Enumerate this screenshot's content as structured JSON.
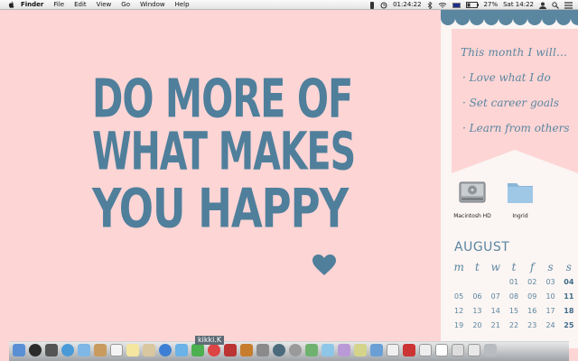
{
  "menubar": {
    "items": [
      "Finder",
      "File",
      "Edit",
      "View",
      "Go",
      "Window",
      "Help"
    ],
    "clock": "01:24:22",
    "battery": "27%",
    "datetime": "Sat 14:22"
  },
  "quote": {
    "line1": "DO MORE OF",
    "line2": "WHAT MAKES",
    "line3": "YOU HAPPY"
  },
  "note": {
    "header": "This month I will...",
    "items": [
      "Love what I do",
      "Set career goals",
      "Learn from others"
    ]
  },
  "desktop": {
    "icons": [
      {
        "label": "Macintosh HD",
        "icon": "hard-drive-icon"
      },
      {
        "label": "Ingrid",
        "icon": "folder-icon"
      }
    ]
  },
  "calendar": {
    "month": "AUGUST",
    "weekdays": [
      "m",
      "t",
      "w",
      "t",
      "f",
      "s",
      "s"
    ],
    "weeks": [
      [
        "",
        "",
        "",
        "",
        "01",
        "02",
        "03",
        "04"
      ],
      [
        "05",
        "06",
        "07",
        "08",
        "09",
        "10",
        "11"
      ],
      [
        "12",
        "13",
        "14",
        "15",
        "16",
        "17",
        "18"
      ],
      [
        "19",
        "20",
        "21",
        "22",
        "23",
        "24",
        "25"
      ]
    ]
  },
  "dock": {
    "label": "kikki.K"
  },
  "colors": {
    "background": "#fdd5d5",
    "accent": "#4f7f9b",
    "panel": "#fbf5f3"
  }
}
